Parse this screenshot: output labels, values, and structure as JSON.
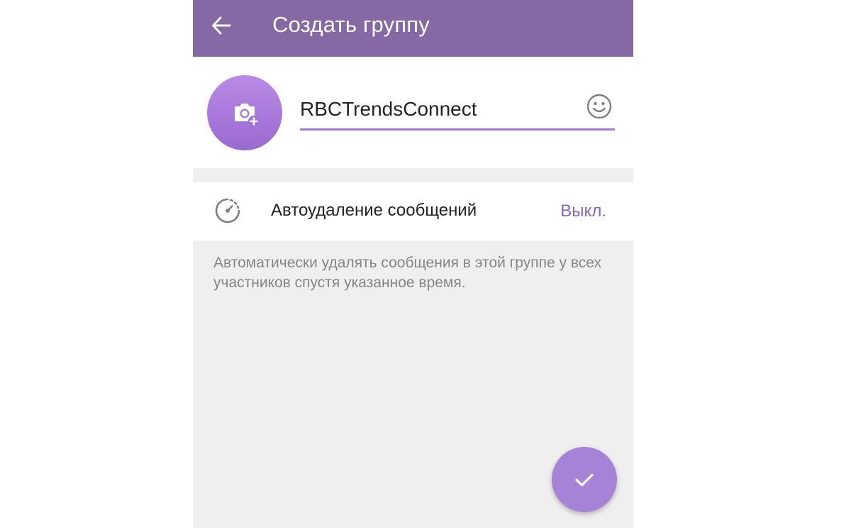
{
  "appbar": {
    "title": "Создать группу",
    "back_icon": "arrow-back-icon",
    "color": "#8469a5"
  },
  "group": {
    "name_value": "RBCTrendsConnect",
    "avatar_icon": "camera-add-icon",
    "emoji_icon": "smiley-icon"
  },
  "auto_delete": {
    "icon": "timer-icon",
    "label": "Автоудаление сообщений",
    "value": "Выкл.",
    "hint": "Автоматически удалять сообщения в этой группе у всех участников спустя указанное время."
  },
  "fab": {
    "icon": "checkmark-icon"
  },
  "colors": {
    "accent": "#a27bd2",
    "value_text": "#8a63c0",
    "background": "#efefef"
  }
}
